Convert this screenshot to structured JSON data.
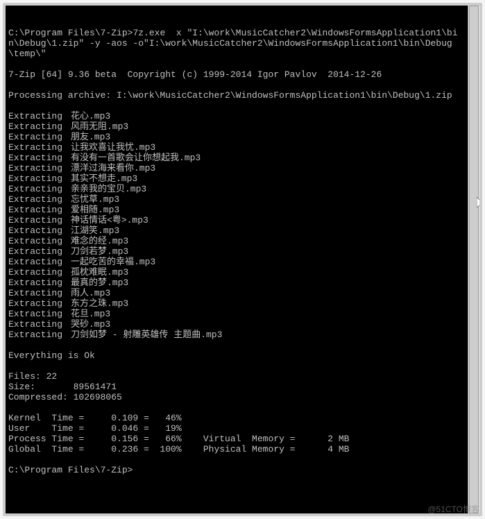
{
  "command": {
    "prompt": "C:\\Program Files\\7-Zip>",
    "cmd": "7z.exe  x \"I:\\work\\MusicCatcher2\\WindowsFormsApplication1\\bin\\Debug\\1.zip\" -y -aos -o\"I:\\work\\MusicCatcher2\\WindowsFormsApplication1\\bin\\Debug\\temp\\\""
  },
  "version_line": "7-Zip [64] 9.36 beta  Copyright (c) 1999-2014 Igor Pavlov  2014-12-26",
  "processing_line": "Processing archive: I:\\work\\MusicCatcher2\\WindowsFormsApplication1\\bin\\Debug\\1.zip",
  "extract_label": "Extracting",
  "files": [
    "花心.mp3",
    "风雨无阻.mp3",
    "朋友.mp3",
    "让我欢喜让我忧.mp3",
    "有没有一首歌会让你想起我.mp3",
    "漂洋过海来看你.mp3",
    "其实不想走.mp3",
    "亲亲我的宝贝.mp3",
    "忘忧草.mp3",
    "爱相随.mp3",
    "神话情话<粤>.mp3",
    "江湖笑.mp3",
    "难念的经.mp3",
    "刀剑若梦.mp3",
    "一起吃苦的幸福.mp3",
    "孤枕难眠.mp3",
    "最真的梦.mp3",
    "雨人.mp3",
    "东方之珠.mp3",
    "花旦.mp3",
    "哭砂.mp3",
    "刀剑如梦 - 射雕英雄传 主题曲.mp3"
  ],
  "result_line": "Everything is Ok",
  "stats": {
    "files_label": "Files: 22",
    "size_label": "Size:       89561471",
    "comp_label": "Compressed: 102698065"
  },
  "timing": {
    "kernel": "Kernel  Time =     0.109 =   46%",
    "user": "User    Time =     0.046 =   19%",
    "process": "Process Time =     0.156 =   66%    Virtual  Memory =      2 MB",
    "global": "Global  Time =     0.236 =  100%    Physical Memory =      4 MB"
  },
  "end_prompt": "C:\\Program Files\\7-Zip>",
  "watermark": "@51CTO博客"
}
